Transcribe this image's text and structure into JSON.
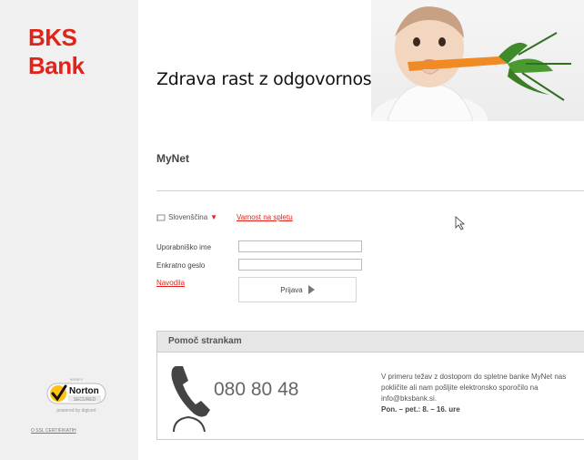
{
  "brand": {
    "logo_text": "BKS Bank"
  },
  "banner": {
    "tagline": "Zdrava rast z odgovornostjo."
  },
  "app": {
    "title": "MyNet"
  },
  "language": {
    "current": "Slovenščina"
  },
  "links": {
    "safety": "Varnost na spletu",
    "help": "Navodila"
  },
  "form": {
    "username_label": "Uporabniško ime",
    "password_label": "Enkratno geslo",
    "username_value": "",
    "password_value": "",
    "login_label": "Prijava"
  },
  "support": {
    "heading": "Pomoč strankam",
    "phone": "080 80 48",
    "text": "V primeru težav z dostopom do spletne banke MyNet nas pokličite ali nam pošljite elektronsko sporočilo na info@bksbank.si.",
    "hours": "Pon. – pet.: 8. – 16. ure"
  },
  "security": {
    "norton_verify": "VERIFY",
    "norton_name": "Norton",
    "norton_secured": "SECURED",
    "powered_by": "powered by digicert",
    "ssl_link": "O SSL CERTIFIKATIH"
  },
  "colors": {
    "brand_red": "#e2231a"
  }
}
